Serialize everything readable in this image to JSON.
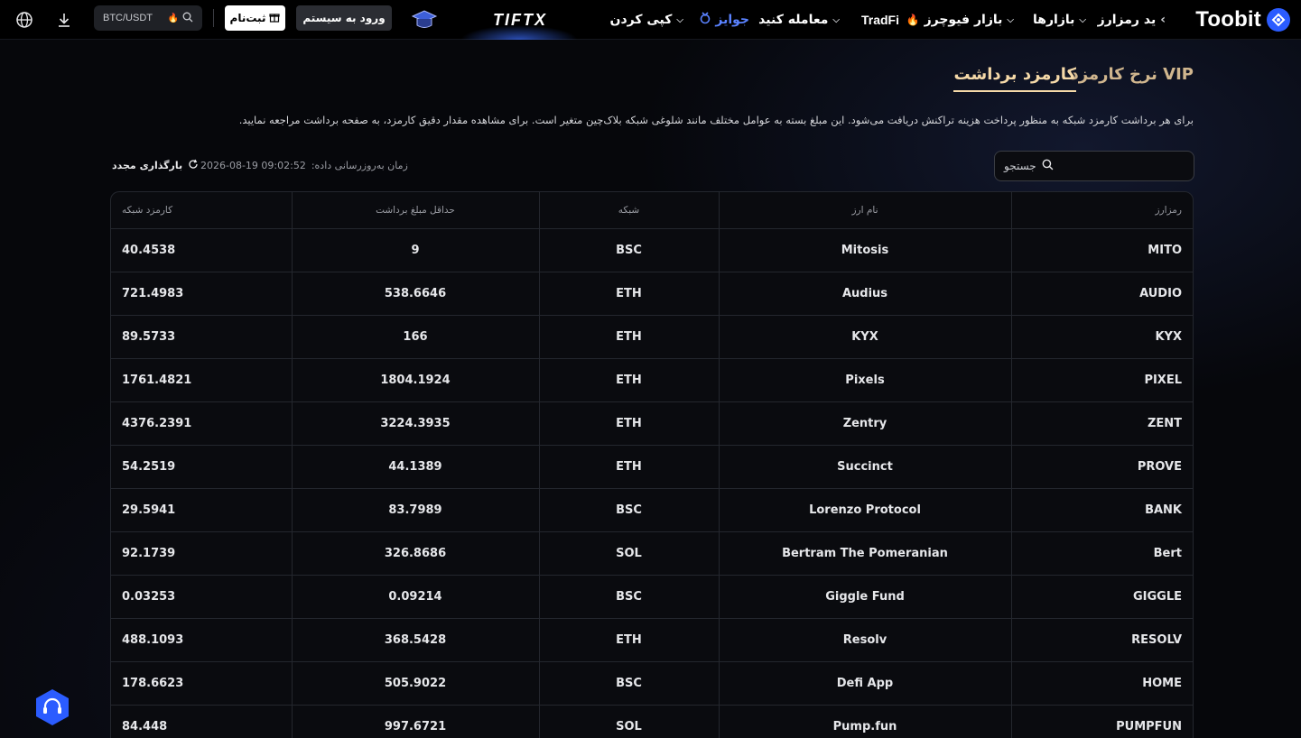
{
  "header": {
    "logo_text": "Toobit",
    "nav": [
      {
        "label": "ید رمزارز",
        "chevron": true
      },
      {
        "label": "بازارها",
        "chevron": true
      },
      {
        "label": "بازار فیوچرز",
        "chevron": true,
        "icon": "fire-icon"
      },
      {
        "label": "TradFi",
        "chevron": false
      },
      {
        "label": "معامله کنید",
        "chevron": true
      },
      {
        "label": "جوایز",
        "chevron": false,
        "icon": "medal-icon"
      },
      {
        "label": "کپی کردن",
        "chevron": true
      }
    ],
    "brand_banner": "TIFTX",
    "login_label": "ورود به سیستم",
    "signup_label": "ثبت‌نام",
    "search_pair": "BTC/USDT"
  },
  "tabs": {
    "active": "کارمزد برداشت",
    "vip": "نرخ کارمزد VIP"
  },
  "description": "برای هر برداشت کارمزد شبکه به منظور پرداخت هزینه تراکنش دریافت می‌شود. این مبلغ بسته به عوامل مختلف مانند شلوغی شبکه بلاک‌چین متغیر است. برای مشاهده مقدار دقیق کارمزد، به صفحه برداشت مراجعه نمایید.",
  "search": {
    "placeholder": "جستجو"
  },
  "updated": {
    "label": "زمان به‌روزرسانی داده:",
    "value": "2026-08-19 09:02:52"
  },
  "reload_label": "بارگذاری مجدد",
  "table": {
    "headers": {
      "symbol": "رمزارز",
      "name": "نام ارز",
      "network": "شبکه",
      "min": "حداقل مبلغ برداشت",
      "fee": "کارمزد شبکه"
    },
    "rows": [
      {
        "symbol": "MITO",
        "name": "Mitosis",
        "network": "BSC",
        "min": "9",
        "fee": "40.4538"
      },
      {
        "symbol": "AUDIO",
        "name": "Audius",
        "network": "ETH",
        "min": "538.6646",
        "fee": "721.4983"
      },
      {
        "symbol": "KYX",
        "name": "KYX",
        "network": "ETH",
        "min": "166",
        "fee": "89.5733"
      },
      {
        "symbol": "PIXEL",
        "name": "Pixels",
        "network": "ETH",
        "min": "1804.1924",
        "fee": "1761.4821"
      },
      {
        "symbol": "ZENT",
        "name": "Zentry",
        "network": "ETH",
        "min": "3224.3935",
        "fee": "4376.2391"
      },
      {
        "symbol": "PROVE",
        "name": "Succinct",
        "network": "ETH",
        "min": "44.1389",
        "fee": "54.2519"
      },
      {
        "symbol": "BANK",
        "name": "Lorenzo Protocol",
        "network": "BSC",
        "min": "83.7989",
        "fee": "29.5941"
      },
      {
        "symbol": "Bert",
        "name": "Bertram The Pomeranian",
        "network": "SOL",
        "min": "326.8686",
        "fee": "92.1739"
      },
      {
        "symbol": "GIGGLE",
        "name": "Giggle Fund",
        "network": "BSC",
        "min": "0.09214",
        "fee": "0.03253"
      },
      {
        "symbol": "RESOLV",
        "name": "Resolv",
        "network": "ETH",
        "min": "368.5428",
        "fee": "488.1093"
      },
      {
        "symbol": "HOME",
        "name": "Defi App",
        "network": "BSC",
        "min": "505.9022",
        "fee": "178.6623"
      },
      {
        "symbol": "PUMPFUN",
        "name": "Pump.fun",
        "network": "SOL",
        "min": "997.6721",
        "fee": "84.448"
      }
    ]
  },
  "colors": {
    "accent_gold": "#f5d9a8",
    "brand_blue": "#2b5cff",
    "rewards_blue": "#5a82ff"
  }
}
